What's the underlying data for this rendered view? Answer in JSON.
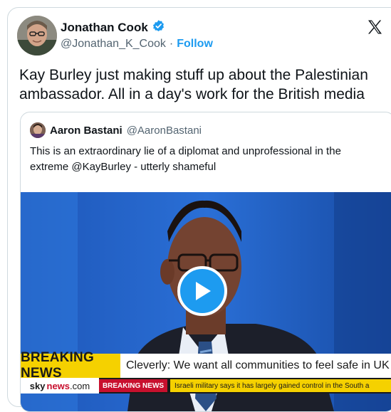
{
  "author": {
    "name": "Jonathan Cook",
    "handle": "@Jonathan_K_Cook",
    "separator": "·",
    "follow_label": "Follow"
  },
  "tweet": {
    "text": "Kay Burley just making stuff up about the Palestinian ambassador. All in a day's work for the British media"
  },
  "quoted": {
    "name": "Aaron Bastani",
    "handle": "@AaronBastani",
    "text": "This is an extraordinary lie of a diplomat and unprofessional in the extreme @KayBurley - utterly shameful"
  },
  "video": {
    "breaking_label": "BREAKING NEWS",
    "headline": "Cleverly: We want all communities to feel safe in UK",
    "logo_sky": "sky",
    "logo_news": "news",
    "logo_com": ".com",
    "ticker_label": "BREAKING NEWS",
    "ticker_text": "Israeli military says it has largely gained control in the South a"
  },
  "icons": {
    "verified": "verified-badge-icon",
    "x_logo": "x-logo-icon",
    "play": "play-icon"
  },
  "colors": {
    "accent": "#1d9bf0",
    "breaking_yellow": "#f5d100",
    "sky_red": "#c8102e"
  }
}
